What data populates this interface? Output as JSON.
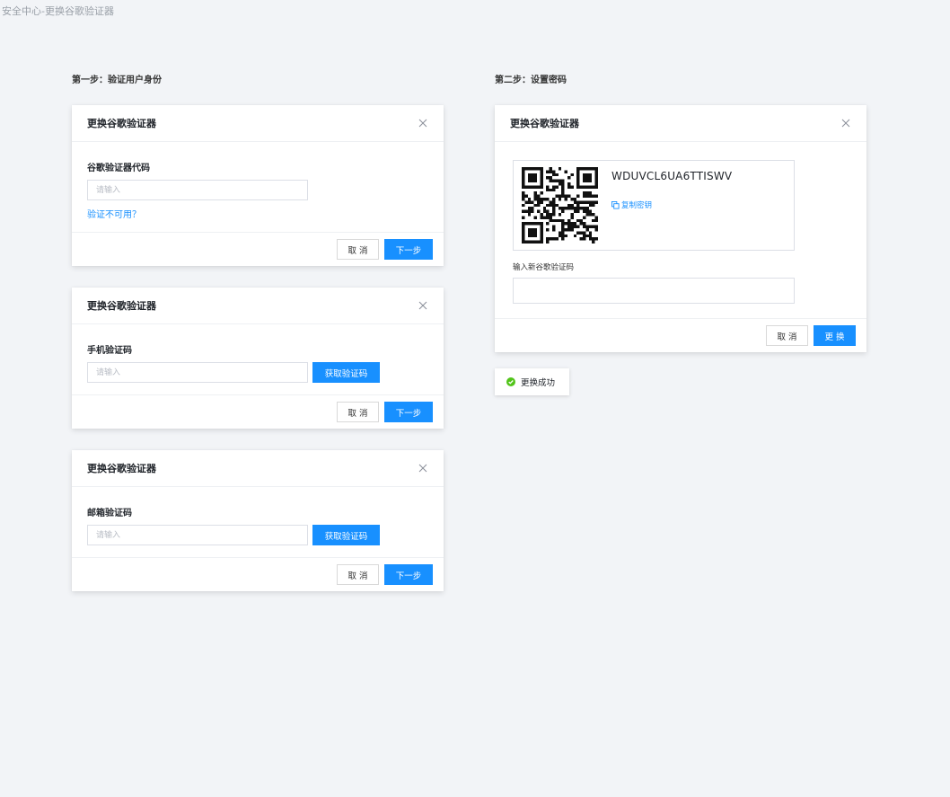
{
  "page_title": "安全中心-更换谷歌验证器",
  "step1": {
    "title": "第一步：验证用户身份"
  },
  "step2": {
    "title": "第二步：设置密码"
  },
  "modal_google": {
    "title": "更换谷歌验证器",
    "field_label": "谷歌验证器代码",
    "placeholder": "请输入",
    "unavailable_link": "验证不可用？",
    "cancel_label": "取 消",
    "next_label": "下一步"
  },
  "modal_phone": {
    "title": "更换谷歌验证器",
    "field_label": "手机验证码",
    "placeholder": "请输入",
    "get_code_label": "获取验证码",
    "cancel_label": "取 消",
    "next_label": "下一步"
  },
  "modal_email": {
    "title": "更换谷歌验证器",
    "field_label": "邮箱验证码",
    "placeholder": "请输入",
    "get_code_label": "获取验证码",
    "cancel_label": "取 消",
    "next_label": "下一步"
  },
  "modal_set": {
    "title": "更换谷歌验证器",
    "secret_key": "WDUVCL6UA6TTISWV",
    "copy_label": "复制密钥",
    "new_code_label": "输入新谷歌验证码",
    "new_code_value": "",
    "cancel_label": "取 消",
    "confirm_label": "更 换"
  },
  "toast": {
    "text": "更换成功",
    "status_color": "#52c41a"
  },
  "colors": {
    "primary": "#1890ff",
    "background": "#f2f4f7"
  },
  "icons": [
    "close-icon",
    "qr-code-icon",
    "copy-icon",
    "success-check-icon"
  ]
}
